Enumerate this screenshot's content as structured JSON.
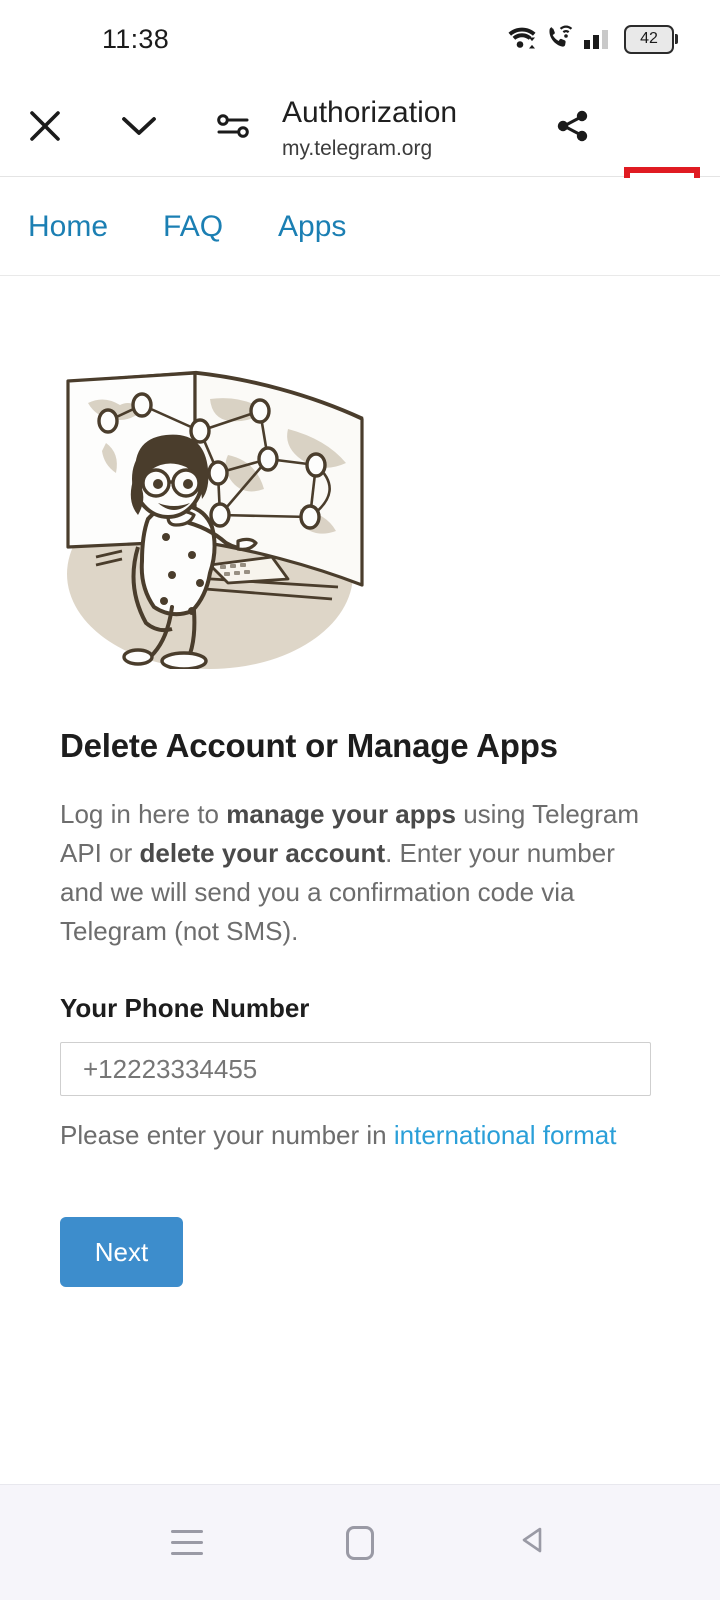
{
  "status_bar": {
    "time": "11:38",
    "battery_level": "42",
    "icons": [
      "wifi-icon",
      "call-over-wifi-icon",
      "cellular-signal-icon",
      "battery-icon"
    ]
  },
  "browser_toolbar": {
    "title": "Authorization",
    "subtitle": "my.telegram.org",
    "close_icon": "close-icon",
    "collapse_icon": "chevron-down-icon",
    "tune_icon": "tune-icon",
    "share_icon": "share-icon",
    "overflow_icon": "more-vertical-icon",
    "highlight_color": "#e01b22"
  },
  "site_nav": {
    "links": [
      {
        "label": "Home"
      },
      {
        "label": "FAQ"
      },
      {
        "label": "Apps"
      }
    ],
    "link_color": "#1b7fb3"
  },
  "main": {
    "illustration_name": "woman-at-network-map-illustration",
    "title": "Delete Account or Manage Apps",
    "description": {
      "part1": "Log in here to ",
      "bold1": "manage your apps",
      "part2": " using Telegram API or ",
      "bold2": "delete your account",
      "part3": ". Enter your number and we will send you a confirmation code via Telegram (not SMS)."
    },
    "form": {
      "phone_label": "Your Phone Number",
      "phone_value": "",
      "phone_placeholder": "+12223334455",
      "help_prefix": "Please enter your number in ",
      "help_link": "international format",
      "submit_label": "Next",
      "submit_color": "#3d8dcc"
    }
  },
  "android_nav": {
    "recents": "recents-icon",
    "home": "home-icon",
    "back": "back-icon"
  }
}
